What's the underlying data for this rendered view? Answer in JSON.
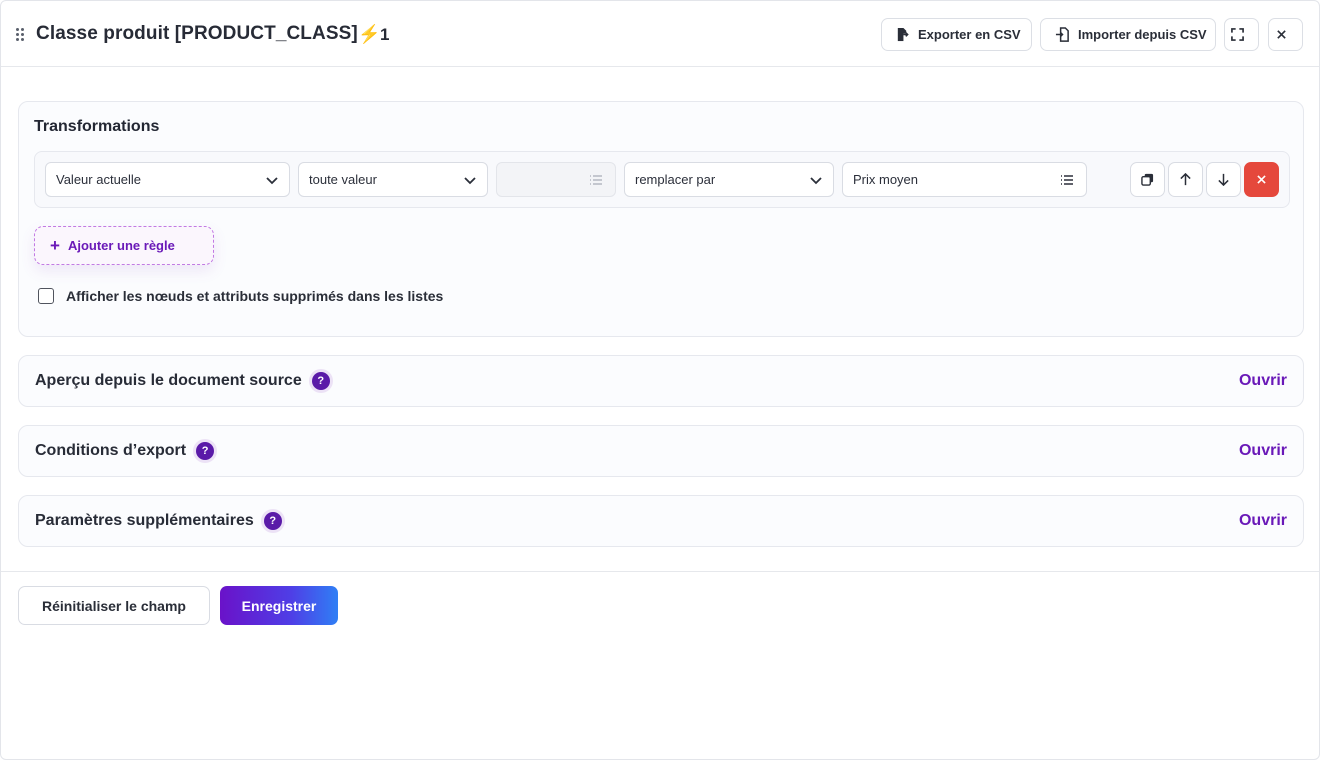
{
  "header": {
    "title": "Classe produit [PRODUCT_CLASS]",
    "count": "1",
    "export_label": "Exporter en CSV",
    "import_label": "Importer depuis CSV"
  },
  "transformations": {
    "title": "Transformations",
    "rule": {
      "source_value": "Valeur actuelle",
      "condition_value": "toute valeur",
      "condition_input": "",
      "action_value": "remplacer par",
      "target_value": "Prix moyen"
    },
    "add_rule_label": "Ajouter une règle",
    "show_deleted_label": "Afficher les nœuds et attributs supprimés dans les listes",
    "show_deleted_checked": false
  },
  "sections": [
    {
      "title": "Aperçu depuis le document source",
      "action": "Ouvrir"
    },
    {
      "title": "Conditions d’export",
      "action": "Ouvrir"
    },
    {
      "title": "Paramètres supplémentaires",
      "action": "Ouvrir"
    }
  ],
  "footer": {
    "reset_label": "Réinitialiser le champ",
    "save_label": "Enregistrer"
  },
  "colors": {
    "accent": "#6a19b8",
    "danger": "#e5483c",
    "bolt": "#f4b400"
  }
}
